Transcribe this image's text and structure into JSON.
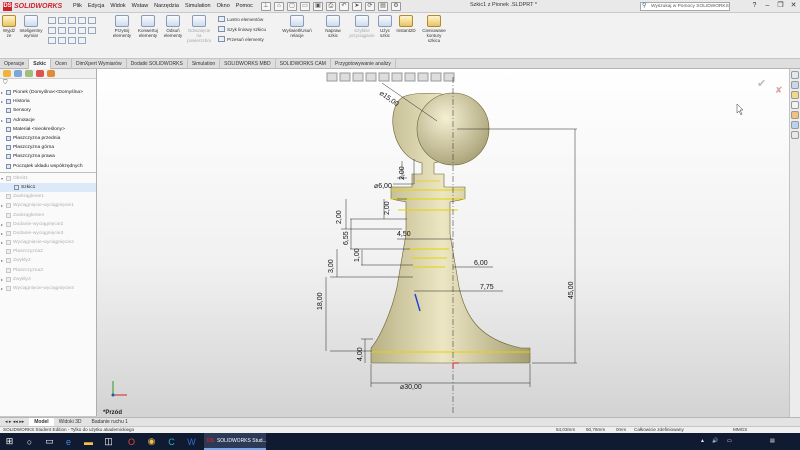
{
  "app": {
    "brand": "SOLIDWORKS",
    "menu": [
      "Plik",
      "Edycja",
      "Widok",
      "Wstaw",
      "Narzędzia",
      "Simulation",
      "Okno",
      "Pomoc"
    ],
    "document_title": "Szkic1 z Pionek .SLDPRT *",
    "search_placeholder": "Wyszukaj w Pomocy SOLIDWORKS",
    "window_buttons": [
      "?",
      "–",
      "❐",
      "✕"
    ]
  },
  "commands": {
    "wyjdz": "Wyjdź ze",
    "inteligentny": "Inteligentny wymiar",
    "przytnij": "Przytnij elementy",
    "konwertuj": "Konwertuj elementy",
    "odsun": "Odsuń elementy",
    "odsuniecie": "Odsunięcie na powierzchni",
    "lustro": "Lustro elementów",
    "szyk": "Szyk liniowy szkicu",
    "przesun": "Przesuń elementy",
    "wyswietl": "Wyświetl/Usuń relacje",
    "napraw": "Napraw szkic",
    "szybkie": "Szybkie przyciąganie",
    "uzyc": "Użyc szkic",
    "instant2d": "Instant2D",
    "cieniowane": "Cieniowane kontury szkicu"
  },
  "tabs": [
    "Operacje",
    "Szkic",
    "Ocen",
    "DimXpert Wymiarów",
    "Dodatki SOLIDWORKS",
    "Simulation",
    "SOLIDWORKS MBD",
    "SOLIDWORKS CAM",
    "Przygotowywanie analizy"
  ],
  "active_tab": "Szkic",
  "tree": [
    {
      "label": "Pionek  (Domyślna<<Domyślna>",
      "style": "normal",
      "level": 0,
      "arrow": "▸"
    },
    {
      "label": "Historia",
      "style": "normal",
      "level": 0,
      "arrow": "▸"
    },
    {
      "label": "Sensory",
      "style": "normal",
      "level": 0,
      "arrow": ""
    },
    {
      "label": "Adnotacje",
      "style": "normal",
      "level": 0,
      "arrow": "▸"
    },
    {
      "label": "Materiał <nieokreślony>",
      "style": "normal",
      "level": 0,
      "arrow": ""
    },
    {
      "label": "Płaszczyzna przednia",
      "style": "normal",
      "level": 0,
      "arrow": ""
    },
    {
      "label": "Płaszczyzna górna",
      "style": "normal",
      "level": 0,
      "arrow": ""
    },
    {
      "label": "Płaszczyzna prawa",
      "style": "normal",
      "level": 0,
      "arrow": ""
    },
    {
      "label": "Początek układu współrzędnych",
      "style": "normal",
      "level": 0,
      "arrow": ""
    },
    {
      "label": "Obrót1",
      "style": "greyed",
      "level": 0,
      "arrow": "▾"
    },
    {
      "label": "Szkic1",
      "style": "sel",
      "level": 1,
      "arrow": ""
    },
    {
      "label": "Zaokrąglenie1",
      "style": "greyed",
      "level": 0,
      "arrow": ""
    },
    {
      "label": "Wyciągnięcie-wyciągnięcie1",
      "style": "greyed",
      "level": 0,
      "arrow": "▸"
    },
    {
      "label": "Zaokrąglenie4",
      "style": "greyed",
      "level": 0,
      "arrow": ""
    },
    {
      "label": "Dodanie-wyciągnięcie2",
      "style": "greyed",
      "level": 0,
      "arrow": "▸"
    },
    {
      "label": "Dodanie-wyciągnięcie3",
      "style": "greyed",
      "level": 0,
      "arrow": "▸"
    },
    {
      "label": "Wyciągnięcie-wyciągnięcie2",
      "style": "greyed",
      "level": 0,
      "arrow": "▸"
    },
    {
      "label": "Płaszczyzna2",
      "style": "greyed",
      "level": 0,
      "arrow": ""
    },
    {
      "label": "Zwykły2",
      "style": "greyed",
      "level": 0,
      "arrow": "▸"
    },
    {
      "label": "Płaszczyzna3",
      "style": "greyed",
      "level": 0,
      "arrow": ""
    },
    {
      "label": "Zwykły3",
      "style": "greyed",
      "level": 0,
      "arrow": "▸"
    },
    {
      "label": "Wyciągnięcie-wyciągnięcie3",
      "style": "greyed",
      "level": 0,
      "arrow": "▸"
    }
  ],
  "dimensions": {
    "sphere": "⌀15,00",
    "neck_dia": "⌀6,00",
    "d2_00_a": "2,00",
    "d2_00_b": "2,00",
    "d2_00_c": "2,00",
    "d6_55": "6,55",
    "d4_50": "4,50",
    "d3_00": "3,00",
    "d1_00": "1,00",
    "d6_00": "6,00",
    "d7_75": "7,75",
    "d18_00": "18,00",
    "d45_00": "45,00",
    "d4_00": "4,00",
    "base_dia": "⌀30,00"
  },
  "view_label": "*Przód",
  "model_tabs": [
    "Model",
    "Widoki 3D",
    "Badanie ruchu 1"
  ],
  "status": {
    "edition": "SOLIDWORKS Student Edition - Tylko do użytku akademickiego",
    "x": "54,03mm",
    "y": "50,76mm",
    "z": "0mm",
    "state": "Całkowicie zdefiniowany",
    "units": "MMGS"
  },
  "taskbar": {
    "app_label": "SOLIDWORKS Stud...",
    "tray": [
      "▲",
      "🔊",
      "▭"
    ]
  }
}
